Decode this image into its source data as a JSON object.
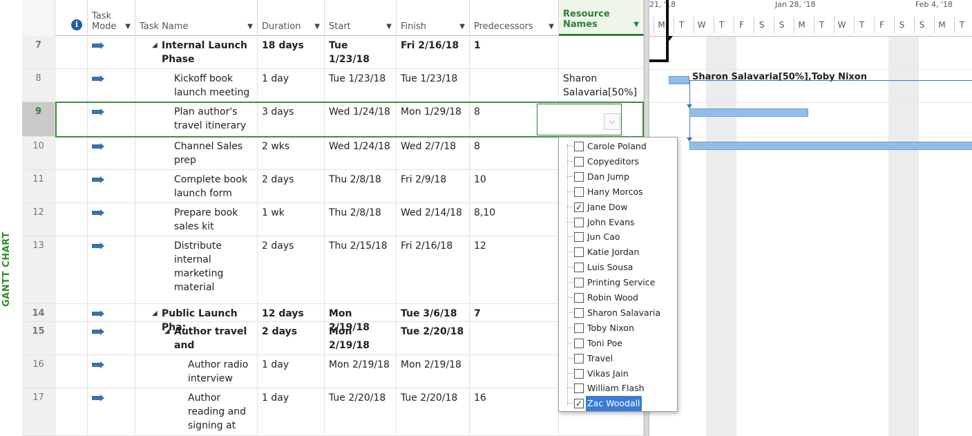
{
  "view_label": "GANTT CHART",
  "columns": {
    "info": "i",
    "task_mode": "Task Mode",
    "task_name": "Task Name",
    "duration": "Duration",
    "start": "Start",
    "finish": "Finish",
    "predecessors": "Predecessors",
    "resource_names": "Resource Names"
  },
  "rows": [
    {
      "id": "7",
      "name": "Internal Launch Phase",
      "duration": "18 days",
      "start": "Tue 1/23/18",
      "finish": "Fri 2/16/18",
      "pred": "1",
      "res": "",
      "summary": true,
      "indent": 1
    },
    {
      "id": "8",
      "name": "Kickoff book launch meeting",
      "duration": "1 day",
      "start": "Tue 1/23/18",
      "finish": "Tue 1/23/18",
      "pred": "",
      "res": "Sharon Salavaria[50%]",
      "summary": false,
      "indent": 2
    },
    {
      "id": "9",
      "name": "Plan author's travel itinerary",
      "duration": "3 days",
      "start": "Wed 1/24/18",
      "finish": "Mon 1/29/18",
      "pred": "8",
      "res": "",
      "summary": false,
      "indent": 2
    },
    {
      "id": "10",
      "name": "Channel Sales prep",
      "duration": "2 wks",
      "start": "Wed 1/24/18",
      "finish": "Wed 2/7/18",
      "pred": "8",
      "res": "",
      "summary": false,
      "indent": 2
    },
    {
      "id": "11",
      "name": "Complete book launch form",
      "duration": "2 days",
      "start": "Thu 2/8/18",
      "finish": "Fri 2/9/18",
      "pred": "10",
      "res": "",
      "summary": false,
      "indent": 2
    },
    {
      "id": "12",
      "name": "Prepare book sales kit",
      "duration": "1 wk",
      "start": "Thu 2/8/18",
      "finish": "Wed 2/14/18",
      "pred": "8,10",
      "res": "",
      "summary": false,
      "indent": 2
    },
    {
      "id": "13",
      "name": "Distribute internal marketing material",
      "duration": "2 days",
      "start": "Thu 2/15/18",
      "finish": "Fri 2/16/18",
      "pred": "12",
      "res": "",
      "summary": false,
      "indent": 2
    },
    {
      "id": "14",
      "name": "Public Launch Pha:",
      "duration": "12 days",
      "start": "Mon 2/19/18",
      "finish": "Tue 3/6/18",
      "pred": "7",
      "res": "",
      "summary": true,
      "indent": 1
    },
    {
      "id": "15",
      "name": "Author travel and",
      "duration": "2 days",
      "start": "Mon 2/19/18",
      "finish": "Tue 2/20/18",
      "pred": "",
      "res": "",
      "summary": true,
      "indent": 2
    },
    {
      "id": "16",
      "name": "Author radio interview",
      "duration": "1 day",
      "start": "Mon 2/19/18",
      "finish": "Mon 2/19/18",
      "pred": "",
      "res": "",
      "summary": false,
      "indent": 3
    },
    {
      "id": "17",
      "name": "Author reading and signing at",
      "duration": "1 day",
      "start": "Tue 2/20/18",
      "finish": "Tue 2/20/18",
      "pred": "16",
      "res": "",
      "summary": false,
      "indent": 3
    }
  ],
  "resource_dropdown": [
    {
      "name": "Carole Poland",
      "checked": false
    },
    {
      "name": "Copyeditors",
      "checked": false
    },
    {
      "name": "Dan Jump",
      "checked": false
    },
    {
      "name": "Hany Morcos",
      "checked": false
    },
    {
      "name": "Jane Dow",
      "checked": true
    },
    {
      "name": "John Evans",
      "checked": false
    },
    {
      "name": "Jun Cao",
      "checked": false
    },
    {
      "name": "Katie Jordan",
      "checked": false
    },
    {
      "name": "Luis Sousa",
      "checked": false
    },
    {
      "name": "Printing Service",
      "checked": false
    },
    {
      "name": "Robin Wood",
      "checked": false
    },
    {
      "name": "Sharon Salavaria",
      "checked": false
    },
    {
      "name": "Toby Nixon",
      "checked": false
    },
    {
      "name": "Toni Poe",
      "checked": false
    },
    {
      "name": "Travel",
      "checked": false
    },
    {
      "name": "Vikas Jain",
      "checked": false
    },
    {
      "name": "William Flash",
      "checked": false
    },
    {
      "name": "Zac Woodall",
      "checked": true,
      "highlighted": true
    }
  ],
  "gantt": {
    "week_labels": [
      "21, '18",
      "Jan 28, '18",
      "Feb 4, '18"
    ],
    "day_labels": [
      "M",
      "T",
      "W",
      "T",
      "F",
      "S",
      "S",
      "M",
      "T",
      "W",
      "T",
      "F",
      "S",
      "S",
      "M",
      "T"
    ],
    "bar_label": "Sharon Salavaria[50%],Toby Nixon",
    "colors": {
      "bar": "#92bde8",
      "link": "#3a74c2",
      "weekend": "#ececec"
    }
  },
  "icons": {
    "task_mode": "auto-scheduled-task-icon",
    "dropdown_arrow": "chevron-down-icon",
    "info": "info-icon"
  }
}
